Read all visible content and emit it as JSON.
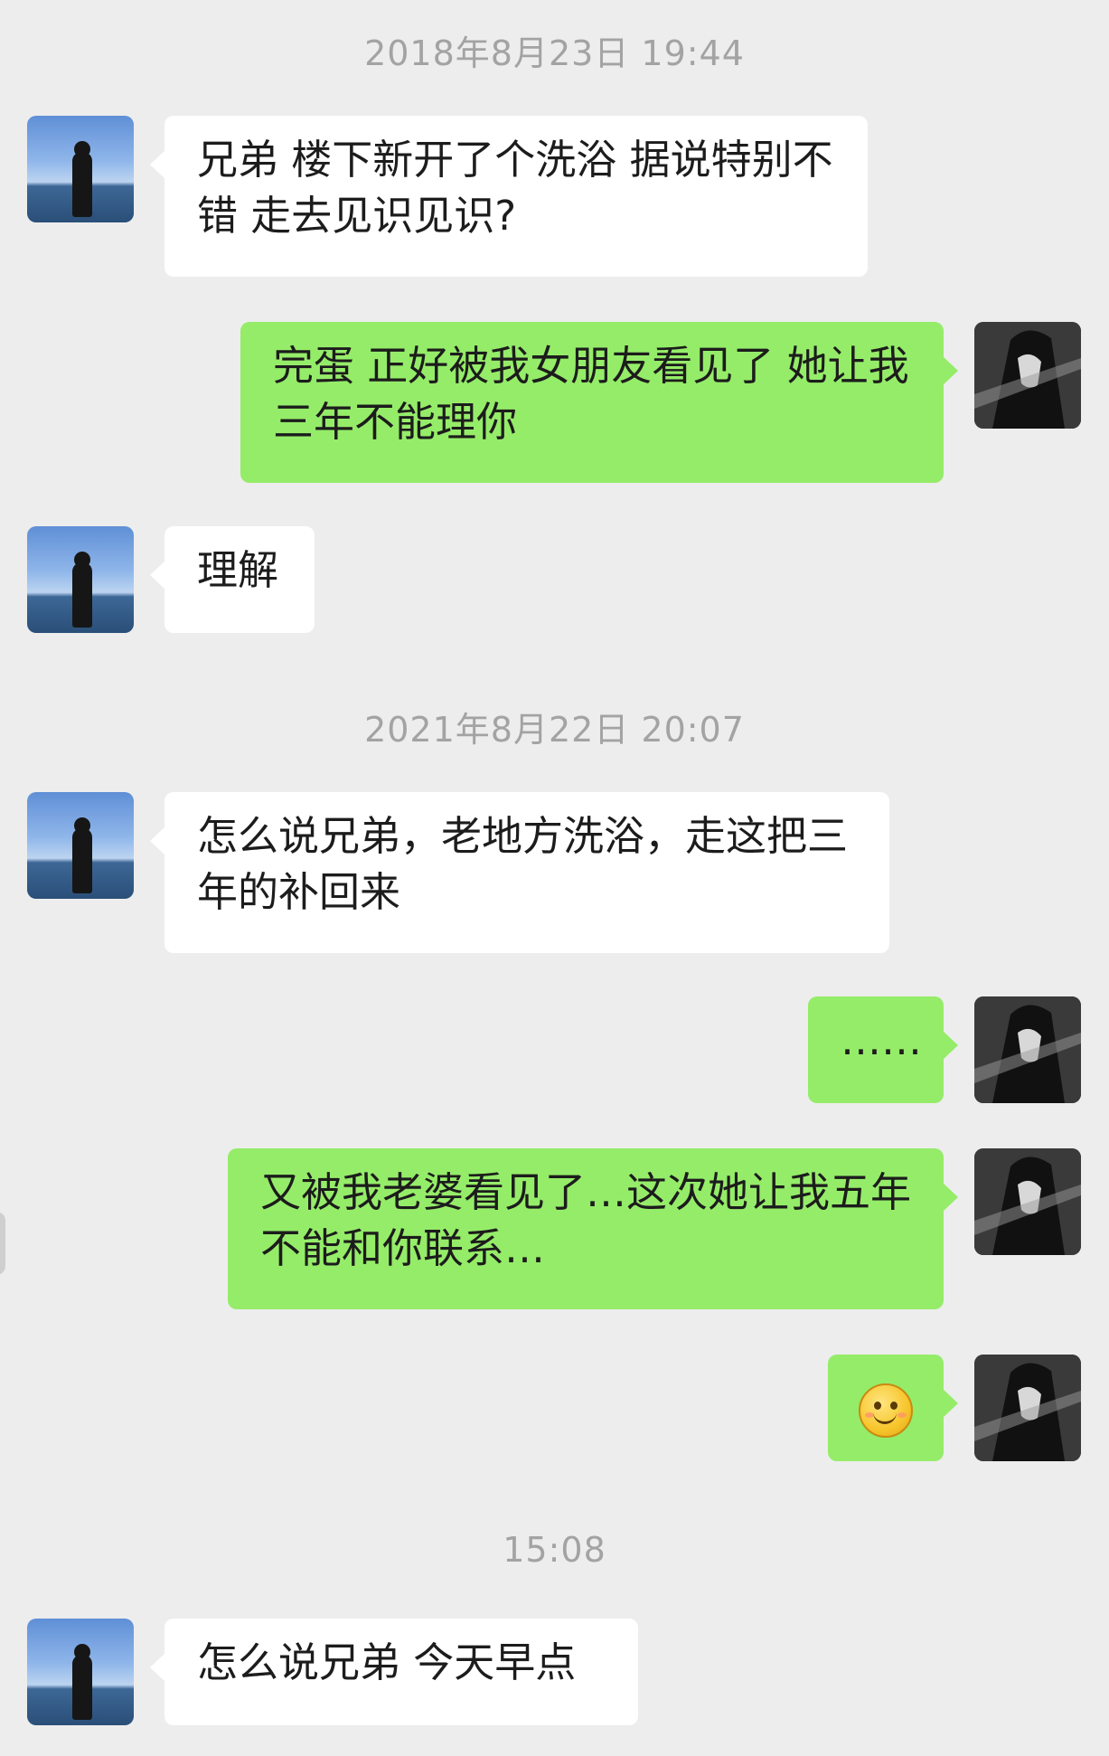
{
  "timestamps": {
    "t1": "2018年8月23日 19:44",
    "t2": "2021年8月22日 20:07",
    "t3": "15:08"
  },
  "messages": [
    {
      "sender": "friend",
      "text": "兄弟 楼下新开了个洗浴 据说特别不错 走去见识见识?"
    },
    {
      "sender": "me",
      "text": "完蛋 正好被我女朋友看见了 她让我三年不能理你"
    },
    {
      "sender": "friend",
      "text": "理解"
    },
    {
      "sender": "friend",
      "text": "怎么说兄弟，老地方洗浴，走这把三年的补回来"
    },
    {
      "sender": "me",
      "text": "……"
    },
    {
      "sender": "me",
      "text": "又被我老婆看见了…这次她让我五年不能和你联系…"
    },
    {
      "sender": "me",
      "emoji": "smile-emoji"
    },
    {
      "sender": "friend",
      "text": "怎么说兄弟 今天早点"
    }
  ],
  "colors": {
    "background": "#ededed",
    "bubble_me": "#95ec69",
    "bubble_friend": "#ffffff",
    "timestamp": "#a3a3a3"
  }
}
